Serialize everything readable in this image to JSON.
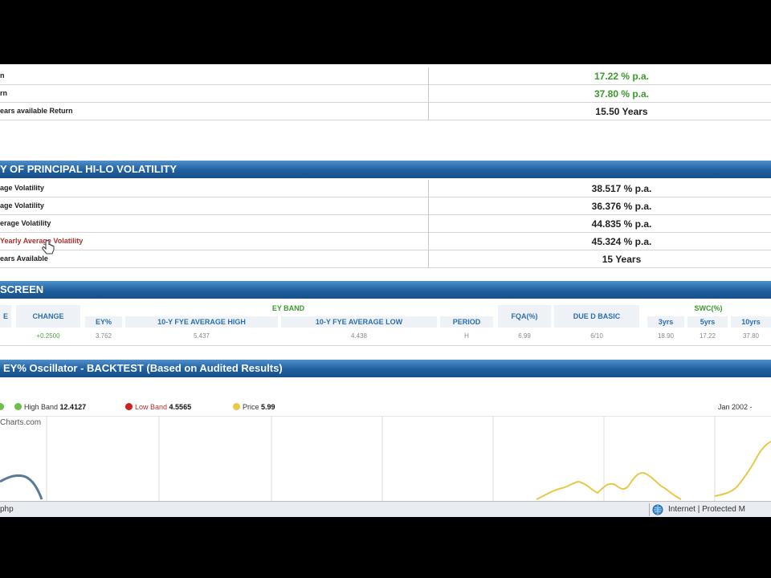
{
  "returns": {
    "rows": [
      {
        "label": "n",
        "value": "17.22 % p.a.",
        "color": "#3a9a2a"
      },
      {
        "label": "rn",
        "value": "37.80 % p.a.",
        "color": "#3a9a2a"
      },
      {
        "label": "ears available Return",
        "value": "15.50 Years",
        "color": "#111111"
      }
    ]
  },
  "volatility": {
    "title": "Y OF PRINCIPAL HI-LO VOLATILITY",
    "rows": [
      {
        "label": "age Volatility",
        "value": "38.517 % p.a."
      },
      {
        "label": "age Volatility",
        "value": "36.376 % p.a."
      },
      {
        "label": "erage Volatility",
        "value": "44.835 % p.a."
      },
      {
        "label": "Yearly Average Volatility",
        "value": "45.324 % p.a."
      },
      {
        "label": "ears Available",
        "value": "15 Years"
      }
    ]
  },
  "screen": {
    "title": "SCREEN",
    "headers": {
      "e": "E",
      "change": "CHANGE",
      "ey_band": "EY BAND",
      "ey_pct": "EY%",
      "avg_high": "10-Y FYE AVERAGE HIGH",
      "avg_low": "10-Y FYE AVERAGE LOW",
      "period": "PERIOD",
      "fqa": "FQA(%)",
      "due_basic": "DUE D BASIC",
      "swc": "SWC(%)",
      "y3": "3yrs",
      "y5": "5yrs",
      "y10": "10yrs"
    },
    "values": {
      "change": "+0.2500",
      "ey_pct": "3.762",
      "avg_high": "5.437",
      "avg_low": "4.438",
      "period": "H",
      "fqa": "6.99",
      "due_basic": "6/10",
      "y3": "18.90",
      "y5": "17.22",
      "y10": "37.80"
    }
  },
  "backtest": {
    "title": "EY% Oscillator - BACKTEST (Based on Audited Results)",
    "legend": [
      {
        "label": "High Band",
        "value": "12.4127",
        "color": "#6cc04a"
      },
      {
        "label": "Low Band",
        "value": "4.5565",
        "color": "#cc2222"
      },
      {
        "label": "Price",
        "value": "5.99",
        "color": "#e8c84a"
      }
    ],
    "date_range": "Jan 2002 - ",
    "watermark": "Charts.com"
  },
  "statusbar": {
    "url": "php",
    "zone": "Internet | Protected M"
  }
}
